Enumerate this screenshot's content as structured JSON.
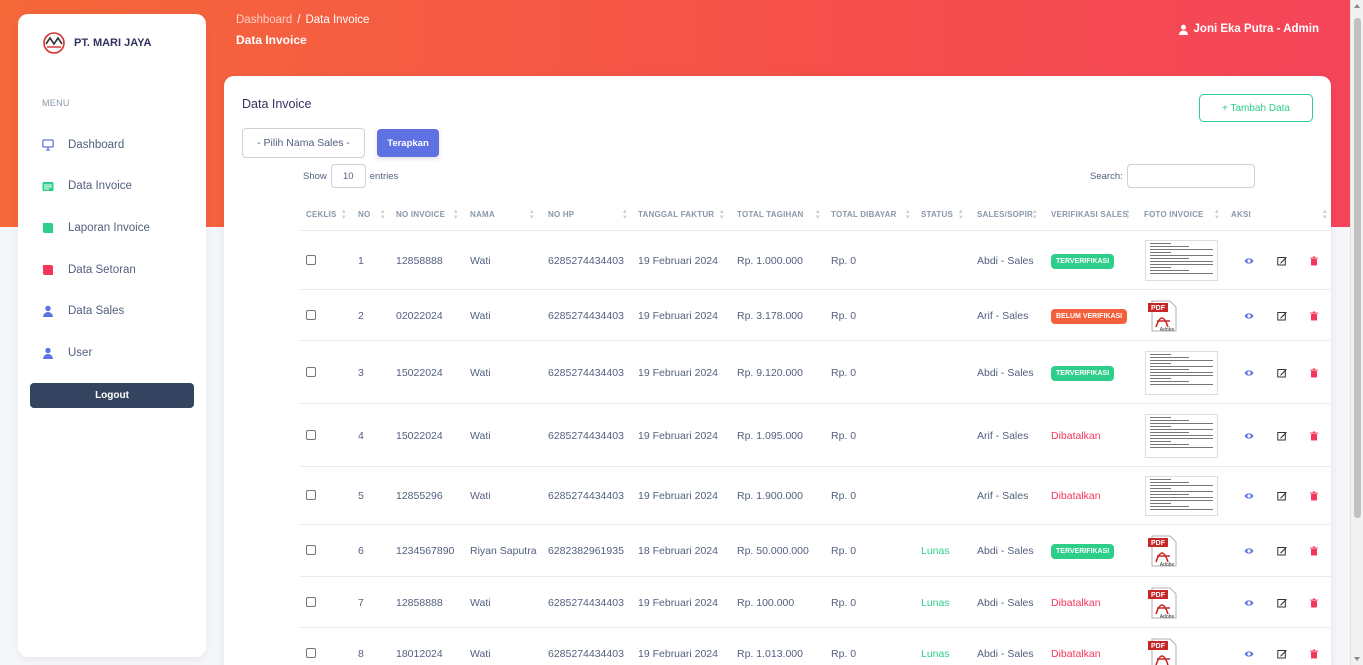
{
  "brand": {
    "name": "PT. MARI JAYA"
  },
  "sidebar": {
    "menu_title": "MENU",
    "items": [
      {
        "label": "Dashboard",
        "icon": "monitor-icon",
        "color": "#5e72e4"
      },
      {
        "label": "Data Invoice",
        "icon": "invoice-icon",
        "color": "#2dce89"
      },
      {
        "label": "Laporan Invoice",
        "icon": "book-icon",
        "color": "#2dce89"
      },
      {
        "label": "Data Setoran",
        "icon": "book-icon",
        "color": "#f5365c"
      },
      {
        "label": "Data Sales",
        "icon": "user-icon",
        "color": "#5e72e4"
      },
      {
        "label": "User",
        "icon": "user-icon",
        "color": "#5e72e4"
      }
    ],
    "logout_label": "Logout"
  },
  "header": {
    "breadcrumb": [
      "Dashboard",
      "Data Invoice"
    ],
    "separator": "/",
    "title": "Data Invoice",
    "user_label": "Joni Eka Putra - Admin"
  },
  "card": {
    "title": "Data Invoice",
    "add_label": "+ Tambah Data",
    "select_label": "- Pilih Nama Sales -",
    "apply_label": "Terapkan",
    "show_label": "Show",
    "show_value": "10",
    "entries_label": "entries",
    "search_label": "Search:",
    "search_value": ""
  },
  "table": {
    "columns": [
      "Ceklis",
      "No",
      "No Invoice",
      "Nama",
      "No HP",
      "Tanggal Faktur",
      "Total Tagihan",
      "Total Dibayar",
      "Status",
      "Sales/Sopir",
      "Verifikasi Sales",
      "Foto Invoice",
      "Aksi"
    ],
    "rows": [
      {
        "no": "1",
        "invoice": "12858888",
        "nama": "Wati",
        "hp": "6285274434403",
        "tanggal": "19 Februari 2024",
        "tagihan": "Rp. 1.000.000",
        "dibayar": "Rp. 0",
        "status": "",
        "sales": "Abdi - Sales",
        "verif": "TERVERIFIKASI",
        "verif_type": "ok",
        "foto": "image"
      },
      {
        "no": "2",
        "invoice": "02022024",
        "nama": "Wati",
        "hp": "6285274434403",
        "tanggal": "19 Februari 2024",
        "tagihan": "Rp. 3.178.000",
        "dibayar": "Rp. 0",
        "status": "",
        "sales": "Arif - Sales",
        "verif": "BELUM VERIFIKASI",
        "verif_type": "no",
        "foto": "pdf"
      },
      {
        "no": "3",
        "invoice": "15022024",
        "nama": "Wati",
        "hp": "6285274434403",
        "tanggal": "19 Februari 2024",
        "tagihan": "Rp. 9.120.000",
        "dibayar": "Rp. 0",
        "status": "",
        "sales": "Abdi - Sales",
        "verif": "TERVERIFIKASI",
        "verif_type": "ok",
        "foto": "image"
      },
      {
        "no": "4",
        "invoice": "15022024",
        "nama": "Wati",
        "hp": "6285274434403",
        "tanggal": "19 Februari 2024",
        "tagihan": "Rp. 1.095.000",
        "dibayar": "Rp. 0",
        "status": "",
        "sales": "Arif - Sales",
        "verif": "Dibatalkan",
        "verif_type": "cancel",
        "foto": "image"
      },
      {
        "no": "5",
        "invoice": "12855296",
        "nama": "Wati",
        "hp": "6285274434403",
        "tanggal": "19 Februari 2024",
        "tagihan": "Rp. 1.900.000",
        "dibayar": "Rp. 0",
        "status": "",
        "sales": "Arif - Sales",
        "verif": "Dibatalkan",
        "verif_type": "cancel",
        "foto": "image"
      },
      {
        "no": "6",
        "invoice": "1234567890",
        "nama": "Riyan Saputra",
        "hp": "6282382961935",
        "tanggal": "18 Februari 2024",
        "tagihan": "Rp. 50.000.000",
        "dibayar": "Rp. 0",
        "status": "Lunas",
        "sales": "Abdi - Sales",
        "verif": "TERVERIFIKASI",
        "verif_type": "ok",
        "foto": "pdf"
      },
      {
        "no": "7",
        "invoice": "12858888",
        "nama": "Wati",
        "hp": "6285274434403",
        "tanggal": "19 Februari 2024",
        "tagihan": "Rp. 100.000",
        "dibayar": "Rp. 0",
        "status": "Lunas",
        "sales": "Abdi - Sales",
        "verif": "Dibatalkan",
        "verif_type": "cancel",
        "foto": "pdf"
      },
      {
        "no": "8",
        "invoice": "18012024",
        "nama": "Wati",
        "hp": "6285274434403",
        "tanggal": "19 Februari 2024",
        "tagihan": "Rp. 1.013.000",
        "dibayar": "Rp. 0",
        "status": "Lunas",
        "sales": "Abdi - Sales",
        "verif": "Dibatalkan",
        "verif_type": "cancel",
        "foto": "pdf"
      }
    ],
    "pdf_text": "PDF",
    "pdf_sub": "Adobe"
  },
  "colors": {
    "accent": "#5e72e4",
    "success": "#2dce89",
    "danger": "#f5365c",
    "header_start": "#f5683a",
    "header_end": "#f5455a",
    "dark": "#344460"
  }
}
